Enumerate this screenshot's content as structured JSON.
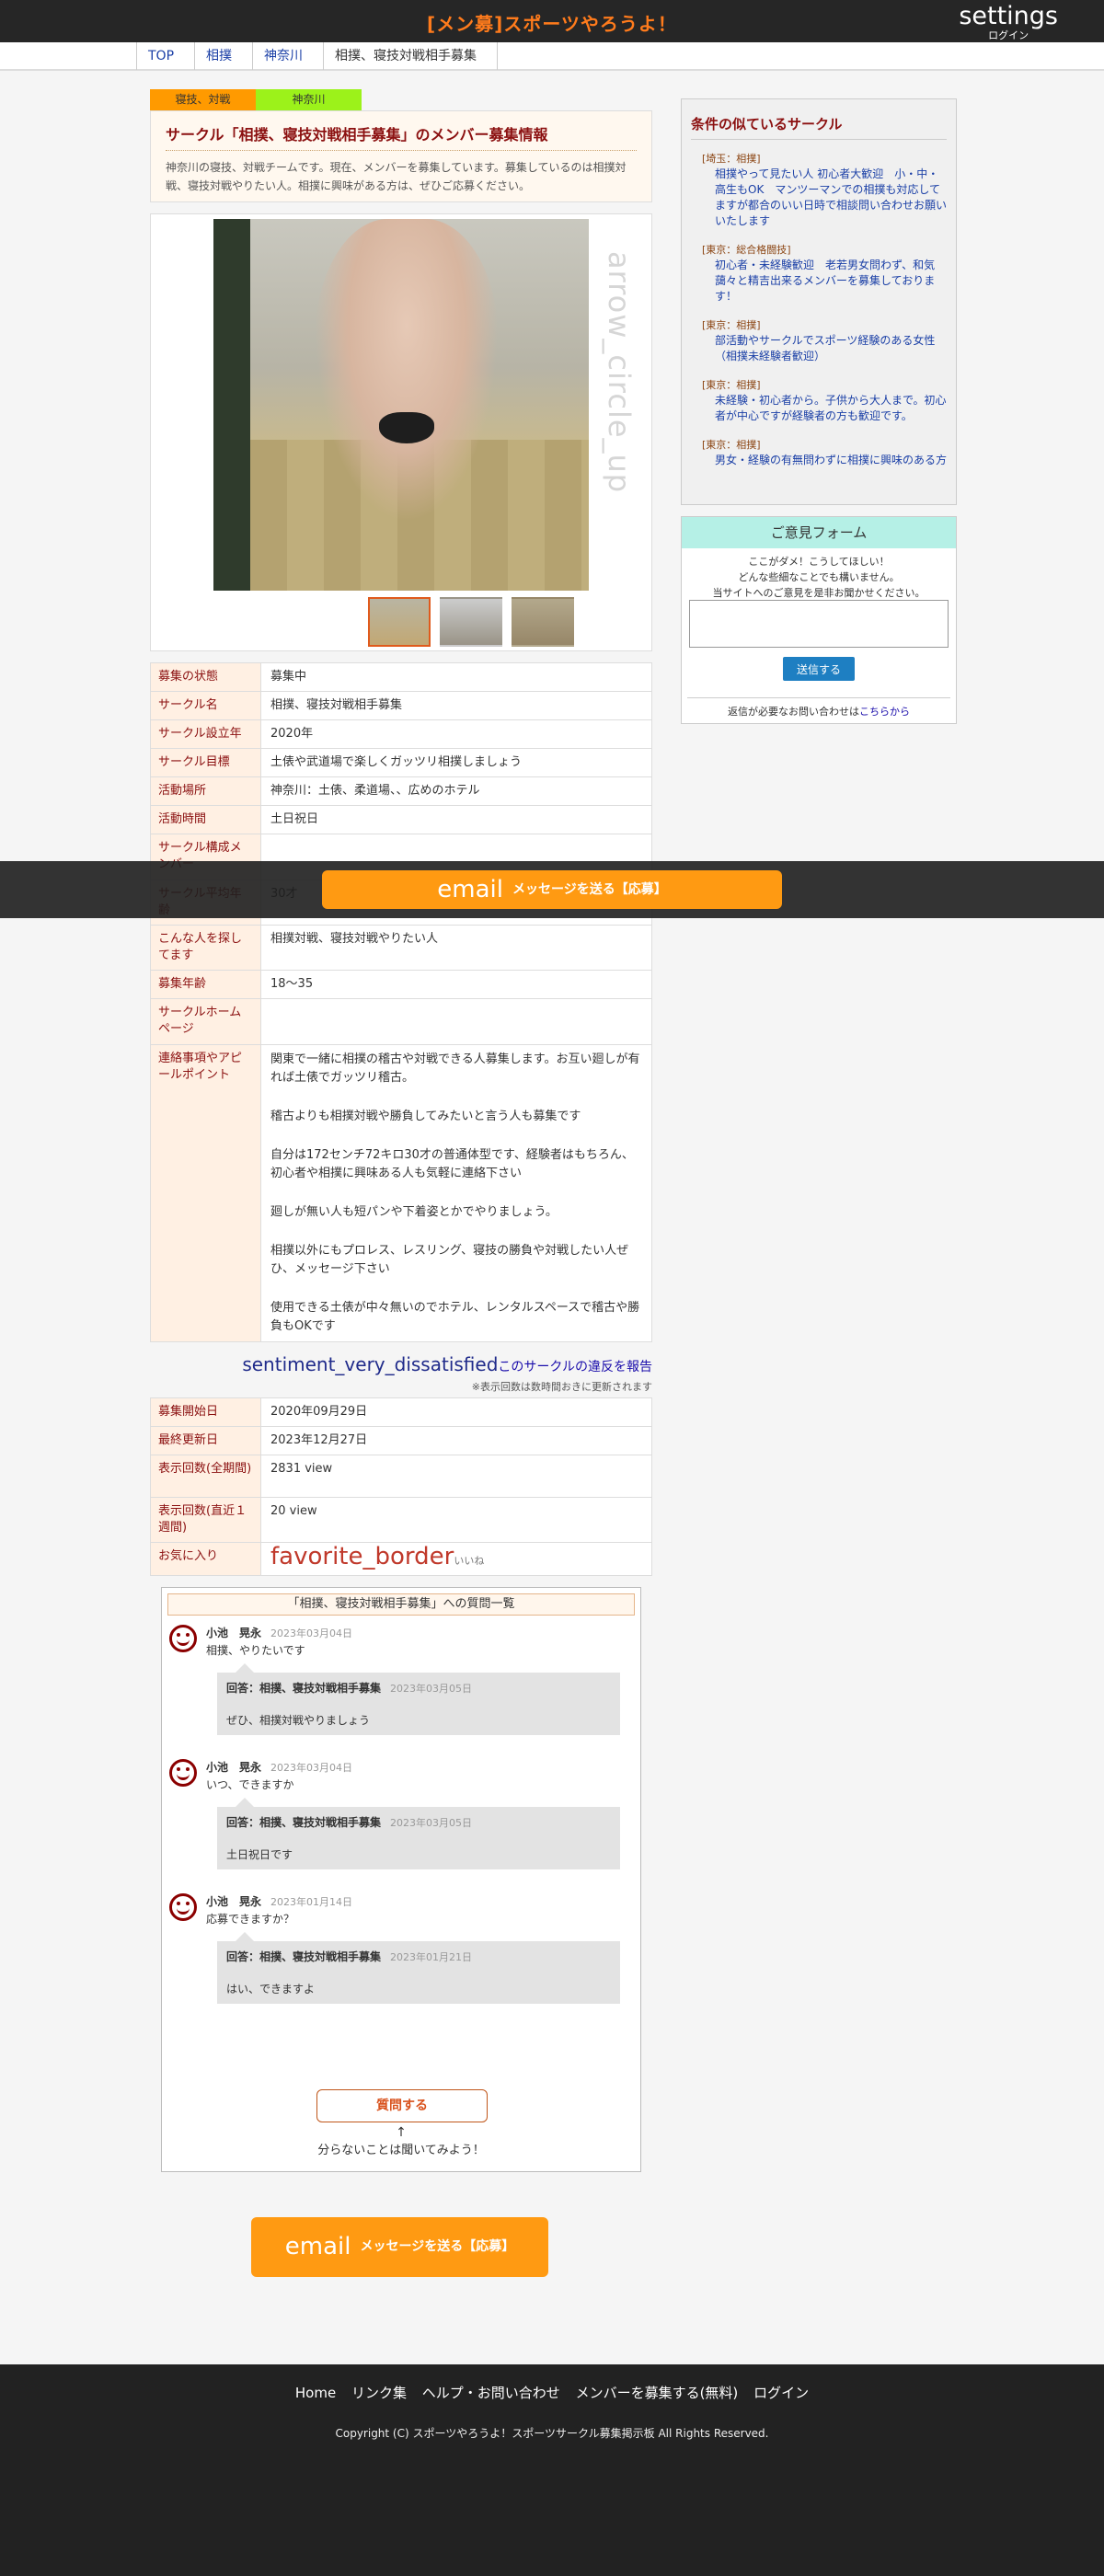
{
  "header": {
    "site_title": "[メン募]スポーツやろうよ！",
    "settings_icon": "settings",
    "settings_label": "ログイン"
  },
  "breadcrumb": [
    "TOP",
    "相撲",
    "神奈川",
    "相撲、寝技対戦相手募集"
  ],
  "tags": [
    "寝技、対戦",
    "神奈川"
  ],
  "intro": {
    "title": "サークル「相撲、寝技対戦相手募集」のメンバー募集情報",
    "text": "神奈川の寝技、対戦チームです。現在、メンバーを募集しています。募集しているのは相撲対戦、寝技対戦やりたい人。相撲に興味がある方は、ぜひご応募ください。"
  },
  "photo": {
    "arrow_icon": "arrow_circle_up"
  },
  "info": [
    {
      "label": "募集の状態",
      "value": "募集中"
    },
    {
      "label": "サークル名",
      "value": "相撲、寝技対戦相手募集"
    },
    {
      "label": "サークル設立年",
      "value": "2020年"
    },
    {
      "label": "サークル目標",
      "value": "土俵や武道場で楽しくガッツリ相撲しましょう"
    },
    {
      "label": "活動場所",
      "value": "神奈川：土俵、柔道場、、広めのホテル"
    },
    {
      "label": "活動時間",
      "value": "土日祝日"
    },
    {
      "label": "サークル構成メンバー",
      "value": ""
    },
    {
      "label": "サークル平均年齢",
      "value": "30才"
    },
    {
      "label": "こんな人を探してます",
      "value": "相撲対戦、寝技対戦やりたい人"
    },
    {
      "label": "募集年齢",
      "value": "18〜35"
    },
    {
      "label": "サークルホームページ",
      "value": ""
    }
  ],
  "appeal": {
    "label": "連絡事項やアピールポイント",
    "paragraphs": [
      "関東で一緒に相撲の稽古や対戦できる人募集します。お互い廻しが有れば土俵でガッツリ稽古。",
      "稽古よりも相撲対戦や勝負してみたいと言う人も募集です",
      "自分は172センチ72キロ30才の普通体型です、経験者はもちろん、初心者や相撲に興味ある人も気軽に連絡下さい",
      "廻しが無い人も短パンや下着姿とかでやりましょう。",
      "相撲以外にもプロレス、レスリング、寝技の勝負や対戦したい人ぜひ、メッセージ下さい",
      "使用できる土俵が中々無いのでホテル、レンタルスペースで稽古や勝負もOKです"
    ]
  },
  "report": {
    "icon": "sentiment_very_dissatisfied",
    "link": "このサークルの違反を報告"
  },
  "note": "※表示回数は数時間おきに更新されます",
  "stats": [
    {
      "label": "募集開始日",
      "value": "2020年09月29日"
    },
    {
      "label": "最終更新日",
      "value": "2023年12月27日"
    },
    {
      "label": "表示回数(全期間)",
      "value": "2831 view"
    },
    {
      "label": "表示回数(直近１週間)",
      "value": "20 view"
    }
  ],
  "favorite": {
    "label": "お気に入り",
    "icon": "favorite_border",
    "text": "いいね"
  },
  "qa": {
    "title": "「相撲、寝技対戦相手募集」への質問一覧",
    "items": [
      {
        "name": "小池　晃永",
        "date": "2023年03月04日",
        "text": "相撲、やりたいです",
        "answer_head": "回答：相撲、寝技対戦相手募集",
        "answer_date": "2023年03月05日",
        "answer": "ぜひ、相撲対戦やりましょう"
      },
      {
        "name": "小池　晃永",
        "date": "2023年03月04日",
        "text": "いつ、できますか",
        "answer_head": "回答：相撲、寝技対戦相手募集",
        "answer_date": "2023年03月05日",
        "answer": "土日祝日です"
      },
      {
        "name": "小池　晃永",
        "date": "2023年01月14日",
        "text": "応募できますか？",
        "answer_head": "回答：相撲、寝技対戦相手募集",
        "answer_date": "2023年01月21日",
        "answer": "はい、できますよ"
      }
    ],
    "ask_button": "質問する",
    "arrow": "↑",
    "hint": "分らないことは聞いてみよう！"
  },
  "email": {
    "icon": "email",
    "label": "メッセージを送る【応募】"
  },
  "side": {
    "similar_title": "条件の似ているサークル",
    "similar": [
      {
        "cat": "[埼玉：相撲]",
        "text": "相撲やって見たい人 初心者大歓迎　小・中・高生もOK　マンツーマンでの相撲も対応してますが都合のいい日時で相談問い合わせお願いいたします"
      },
      {
        "cat": "[東京：総合格闘技]",
        "text": "初心者・未経験歓迎　老若男女問わず、和気藹々と精吉出来るメンバーを募集しております！"
      },
      {
        "cat": "[東京：相撲]",
        "text": "部活動やサークルでスポーツ経験のある女性（相撲未経験者歓迎）"
      },
      {
        "cat": "[東京：相撲]",
        "text": "未経験・初心者から。子供から大人まで。初心者が中心ですが経験者の方も歓迎です。"
      },
      {
        "cat": "[東京：相撲]",
        "text": "男女・経験の有無問わずに相撲に興味のある方"
      }
    ],
    "form_title": "ご意見フォーム",
    "form_msg": [
      "ここがダメ！こうしてほしい！",
      "どんな些細なことでも構いません。",
      "当サイトへのご意見を是非お聞かせください。"
    ],
    "send_label": "送信する",
    "foot_text": "返信が必要なお問い合わせは",
    "foot_link": "こちらから"
  },
  "footer": {
    "links": [
      "Home",
      "リンク集",
      "ヘルプ・お問い合わせ",
      "メンバーを募集する(無料)",
      "ログイン"
    ],
    "copyright": "Copyright (C) スポーツやろうよ！スポーツサークル募集掲示板 All Rights Reserved."
  }
}
